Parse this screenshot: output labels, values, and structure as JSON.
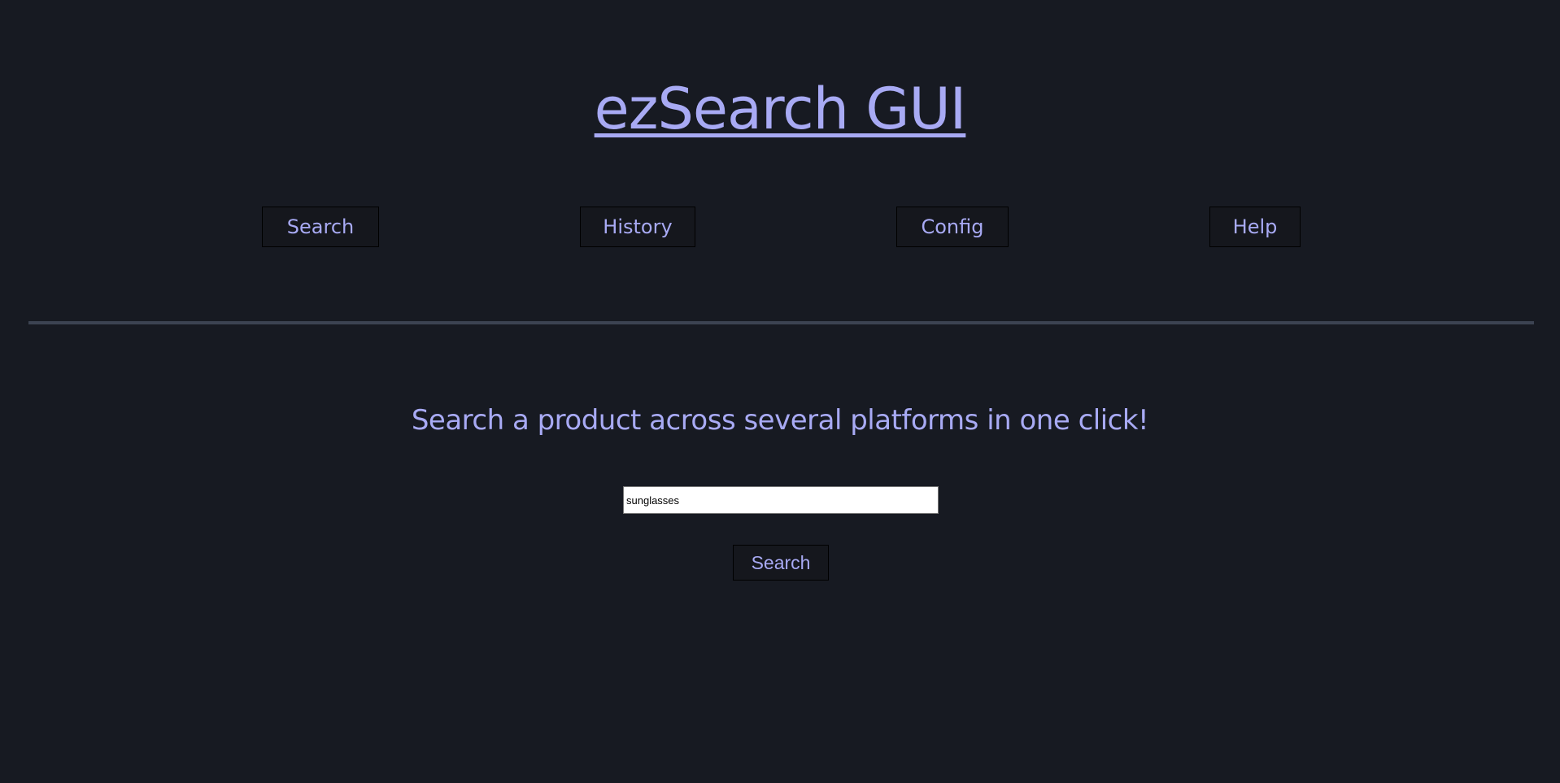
{
  "header": {
    "title": "ezSearch GUI"
  },
  "nav": {
    "search_label": "Search",
    "history_label": "History",
    "config_label": "Config",
    "help_label": "Help"
  },
  "main": {
    "tagline": "Search a product across several platforms in one click!",
    "search_input_value": "sunglasses",
    "search_button_label": "Search"
  },
  "colors": {
    "background": "#171a22",
    "accent": "#a8aaf4",
    "button_bg": "#15171d",
    "divider": "#3c4352"
  }
}
